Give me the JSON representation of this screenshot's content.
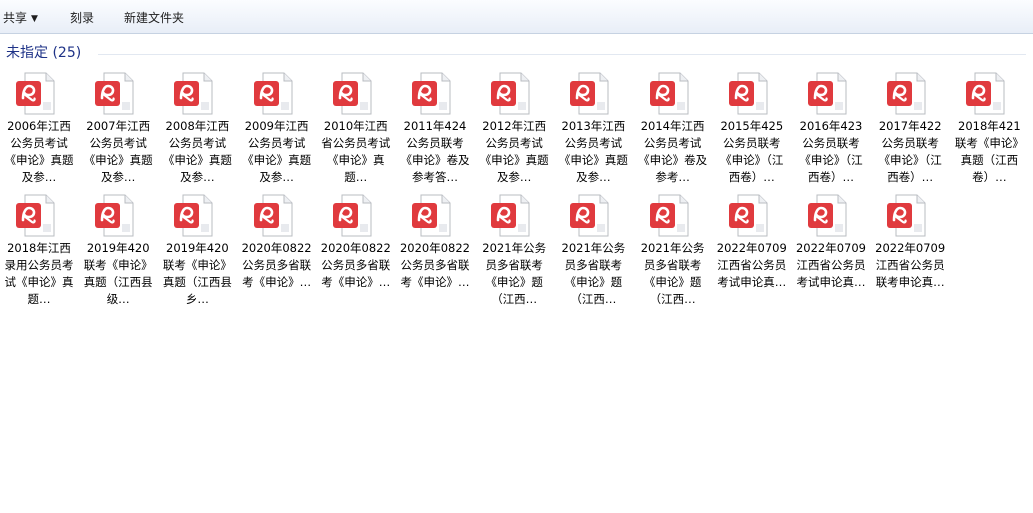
{
  "toolbar": {
    "share_label": "共享",
    "burn_label": "刻录",
    "new_folder_label": "新建文件夹"
  },
  "group": {
    "title": "未指定 (25)"
  },
  "files": [
    {
      "label": "2006年江西公务员考试《申论》真题及参…"
    },
    {
      "label": "2007年江西公务员考试《申论》真题及参…"
    },
    {
      "label": "2008年江西公务员考试《申论》真题及参…"
    },
    {
      "label": "2009年江西公务员考试《申论》真题及参…"
    },
    {
      "label": "2010年江西省公务员考试《申论》真题…"
    },
    {
      "label": "2011年424公务员联考《申论》卷及参考答…"
    },
    {
      "label": "2012年江西公务员考试《申论》真题及参…"
    },
    {
      "label": "2013年江西公务员考试《申论》真题及参…"
    },
    {
      "label": "2014年江西公务员考试《申论》卷及参考…"
    },
    {
      "label": "2015年425公务员联考《申论》（江西卷）…"
    },
    {
      "label": "2016年423公务员联考《申论》（江西卷）…"
    },
    {
      "label": "2017年422公务员联考《申论》（江西卷）…"
    },
    {
      "label": "2018年421联考《申论》真题（江西卷）…"
    },
    {
      "label": "2018年江西录用公务员考试《申论》真题…"
    },
    {
      "label": "2019年420联考《申论》真题（江西县级…"
    },
    {
      "label": "2019年420联考《申论》真题（江西县乡…"
    },
    {
      "label": "2020年0822公务员多省联考《申论》…"
    },
    {
      "label": "2020年0822公务员多省联考《申论》…"
    },
    {
      "label": "2020年0822公务员多省联考《申论》…"
    },
    {
      "label": "2021年公务员多省联考《申论》题（江西…"
    },
    {
      "label": "2021年公务员多省联考《申论》题（江西…"
    },
    {
      "label": "2021年公务员多省联考《申论》题（江西…"
    },
    {
      "label": "2022年0709江西省公务员考试申论真…"
    },
    {
      "label": "2022年0709江西省公务员考试申论真…"
    },
    {
      "label": "2022年0709江西省公务员联考申论真…"
    }
  ],
  "colors": {
    "pdf_red": "#e03a3e",
    "group_title": "#1e3287"
  },
  "icons": {
    "file_icon": "pdf-file-icon"
  }
}
